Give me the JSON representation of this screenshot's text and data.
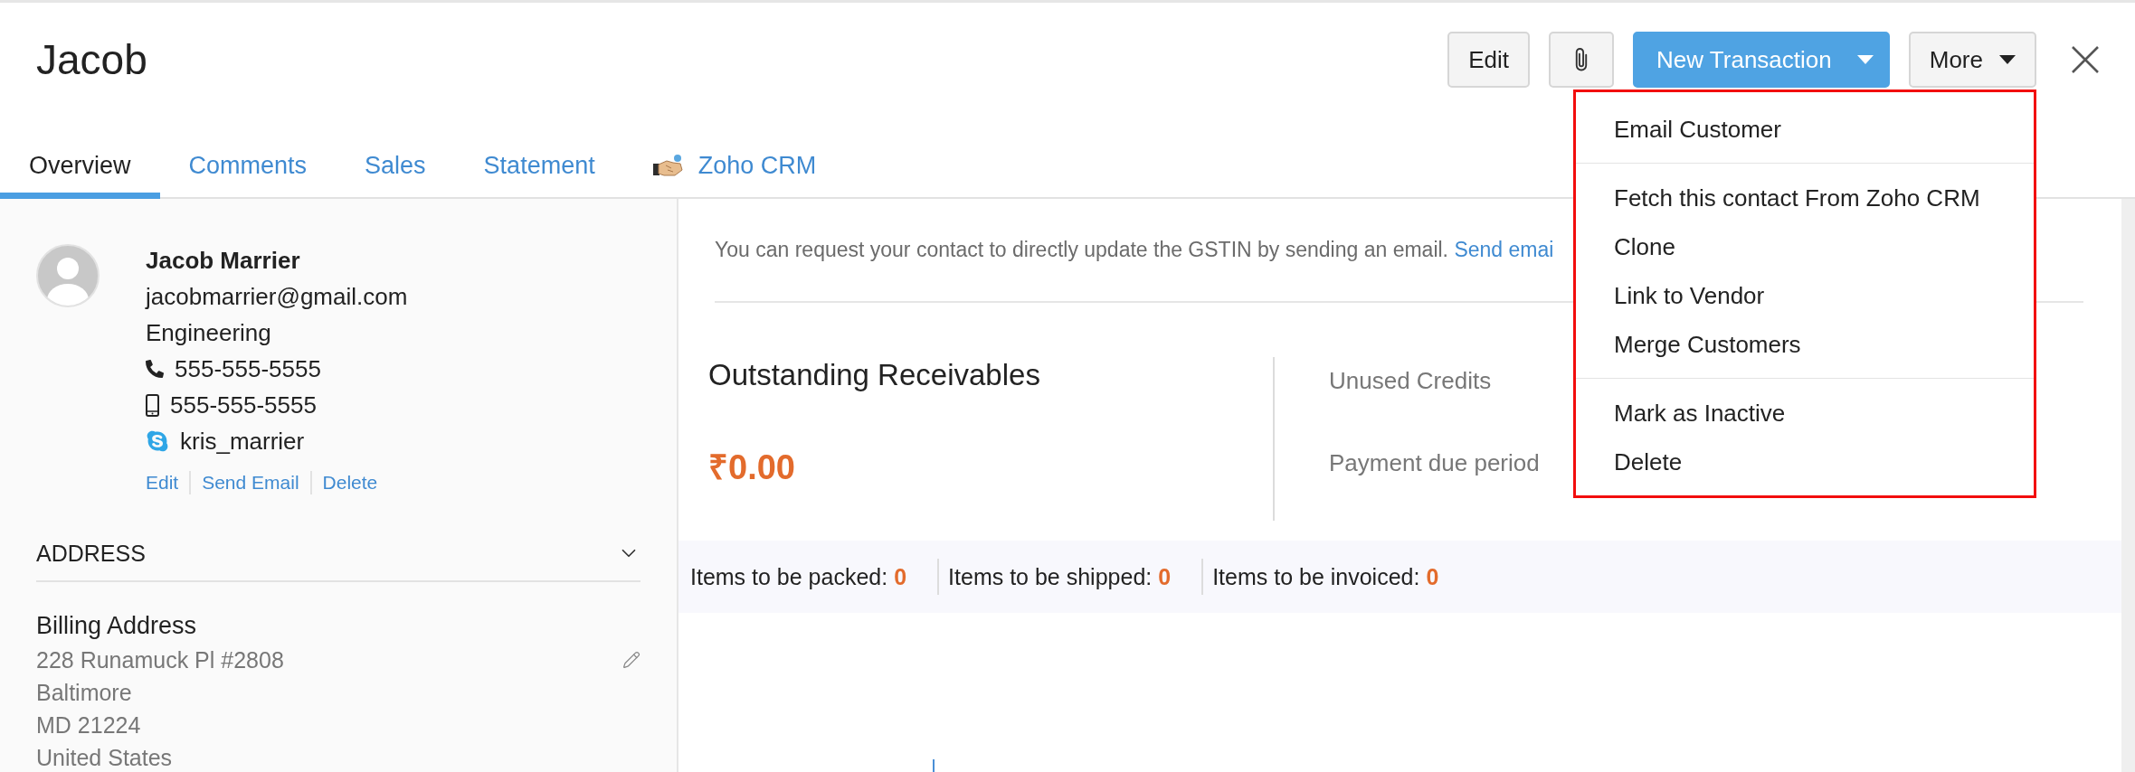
{
  "header": {
    "title": "Jacob",
    "actions": [
      {
        "kind": "text",
        "label": "Edit"
      },
      {
        "kind": "attach"
      },
      {
        "kind": "primary",
        "label": "New Transaction"
      },
      {
        "kind": "menu",
        "label": "More",
        "expanded": true,
        "menu": [
          {
            "items": [
              "Email Customer"
            ]
          },
          {
            "items": [
              "Fetch this contact From Zoho CRM",
              "Clone",
              "Link to Vendor",
              "Merge Customers"
            ]
          },
          {
            "items": [
              "Mark as Inactive",
              "Delete"
            ]
          }
        ]
      }
    ]
  },
  "tabs": [
    {
      "label": "Overview",
      "selected": true,
      "kind": "plain"
    },
    {
      "label": "Comments",
      "selected": false,
      "kind": "plain"
    },
    {
      "label": "Sales",
      "selected": false,
      "kind": "plain"
    },
    {
      "label": "Statement",
      "selected": false,
      "kind": "plain"
    },
    {
      "label": "Zoho CRM",
      "selected": false,
      "kind": "integration"
    }
  ],
  "contact": {
    "name": "Jacob Marrier",
    "email": "jacobmarrier@gmail.com",
    "department": "Engineering",
    "details": [
      {
        "kind": "phone",
        "value": "555-555-5555"
      },
      {
        "kind": "mobile",
        "value": "555-555-5555"
      },
      {
        "kind": "chat",
        "value": "kris_marrier"
      }
    ],
    "links": [
      "Edit",
      "Send Email",
      "Delete"
    ]
  },
  "address": {
    "heading": "ADDRESS",
    "expanded": true,
    "billing": {
      "title": "Billing Address",
      "lines": [
        "228 Runamuck Pl #2808",
        "Baltimore",
        "MD 21224",
        "United States"
      ]
    }
  },
  "notice": {
    "text": "You can request your contact to directly update the GSTIN by sending an email.",
    "link": "Send emai"
  },
  "receivables": {
    "label": "Outstanding Receivables",
    "amount": "₹0.00"
  },
  "details": [
    "Unused Credits",
    "Payment due period"
  ],
  "counts": [
    {
      "label": "Items to be packed:",
      "value": "0"
    },
    {
      "label": "Items to be shipped:",
      "value": "0"
    },
    {
      "label": "Items to be invoiced:",
      "value": "0"
    }
  ]
}
